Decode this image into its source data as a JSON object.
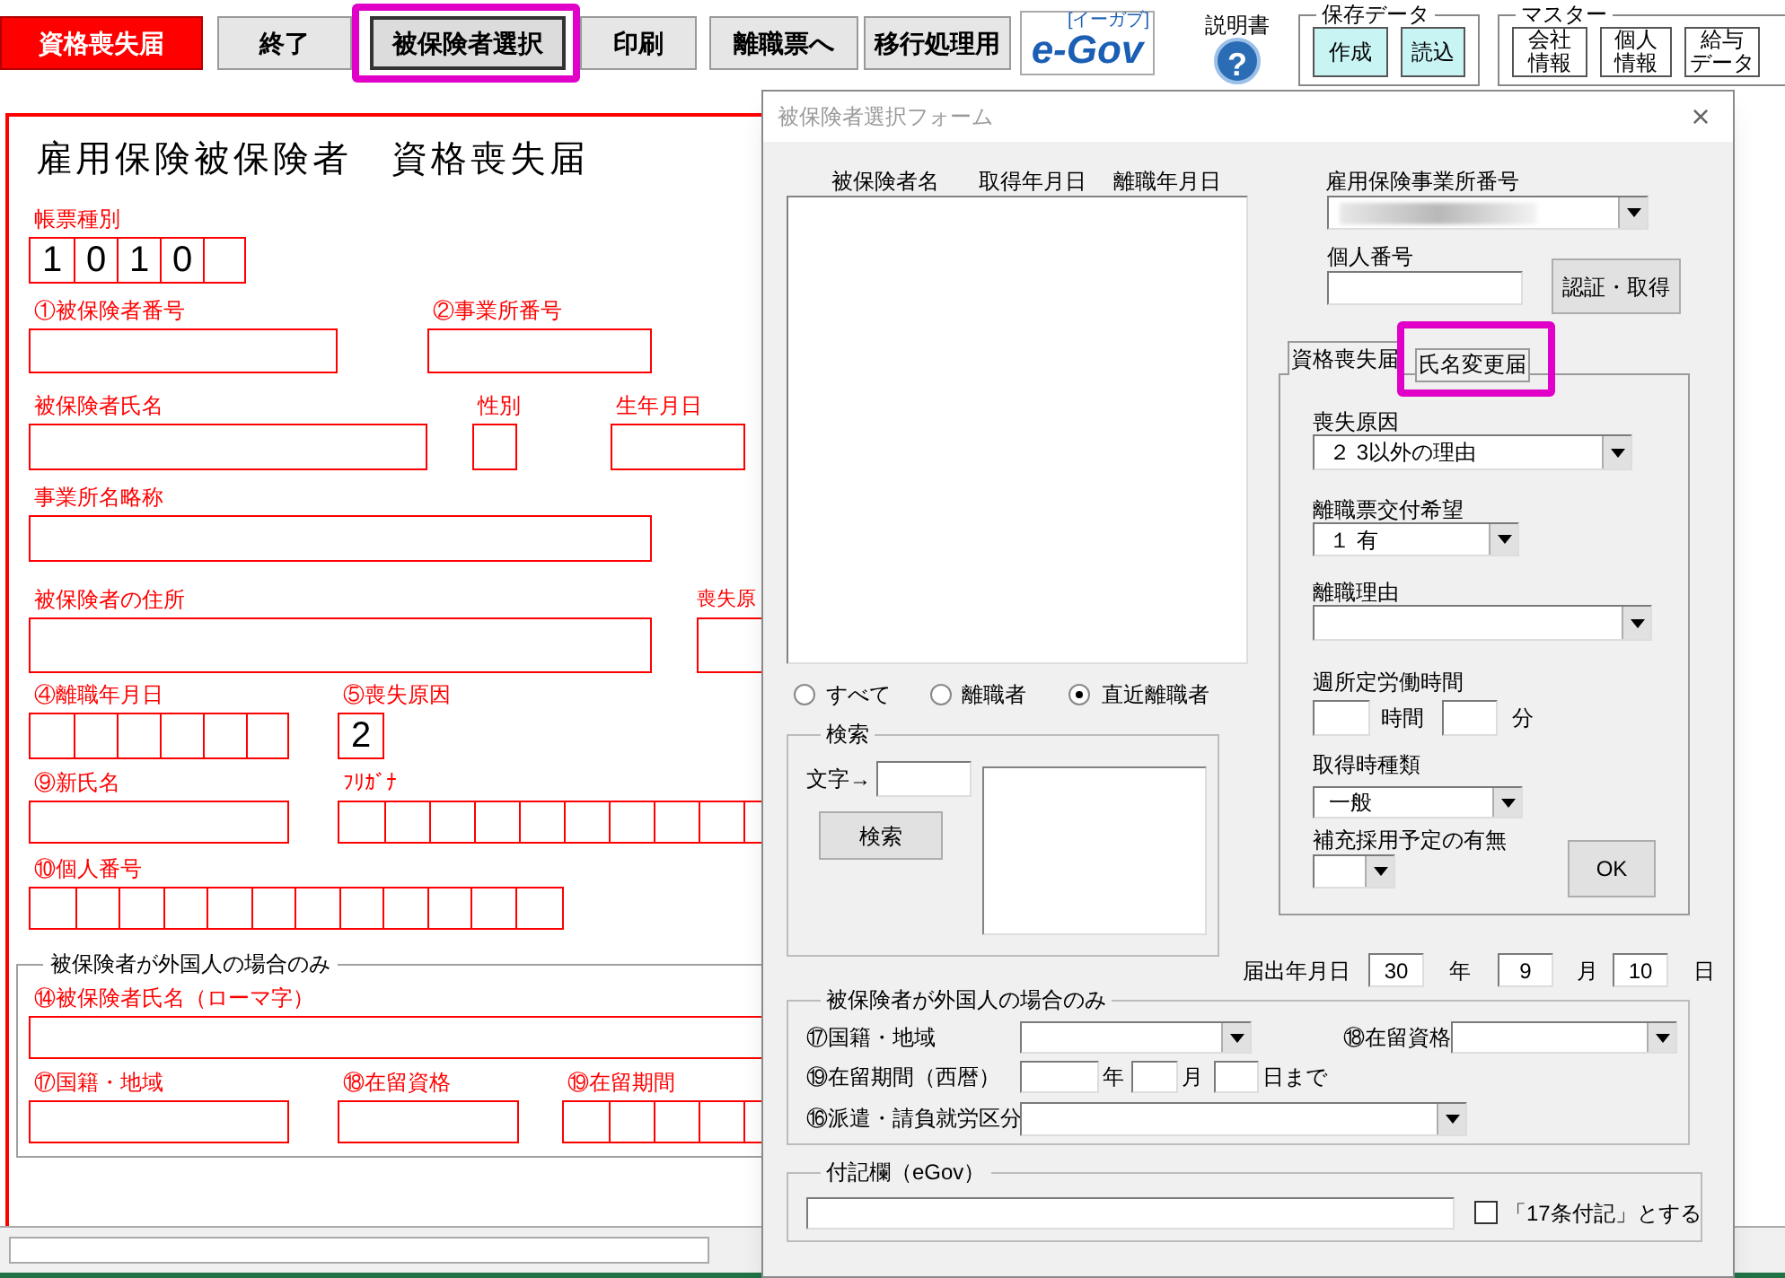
{
  "toolbar": {
    "badge": "資格喪失届",
    "buttons": [
      {
        "label": "終了",
        "selected": false,
        "highlighted": false
      },
      {
        "label": "被保険者選択",
        "selected": true,
        "highlighted": true
      },
      {
        "label": "印刷",
        "selected": false,
        "highlighted": false
      },
      {
        "label": "離職票へ",
        "selected": false,
        "highlighted": false
      },
      {
        "label": "移行処理用",
        "selected": false,
        "highlighted": false
      }
    ],
    "egov": {
      "logo": "e-Gov",
      "reading": "[イーガブ]"
    },
    "help": {
      "label": "説明書",
      "icon": "?"
    },
    "save_data": {
      "title": "保存データ",
      "buttons": [
        "作成",
        "読込"
      ]
    },
    "master": {
      "title": "マスター",
      "buttons": [
        "会社情報",
        "個人情報",
        "給与データ"
      ]
    }
  },
  "sheet": {
    "title": "雇用保険被保険者　資格喪失届",
    "rows": [
      [
        {
          "label": "帳票種別",
          "kind": "cells",
          "values": [
            "1",
            "0",
            "1",
            "0"
          ]
        }
      ],
      [
        {
          "label": "①被保険者番号",
          "kind": "box"
        },
        {
          "label": "②事業所番号",
          "kind": "box"
        }
      ],
      [
        {
          "label": "被保険者氏名",
          "kind": "box"
        },
        {
          "label": "性別",
          "kind": "box"
        },
        {
          "label": "生年月日",
          "kind": "box"
        }
      ],
      [
        {
          "label": "事業所名略称",
          "kind": "box"
        }
      ],
      [
        {
          "label": "被保険者の住所",
          "kind": "box"
        },
        {
          "label": "喪失原",
          "kind": "box"
        }
      ],
      [
        {
          "label": "④離職年月日",
          "kind": "cells"
        },
        {
          "label": "⑤喪失原因",
          "kind": "cells",
          "values": [
            "2"
          ]
        }
      ],
      [
        {
          "label": "⑨新氏名",
          "kind": "box"
        },
        {
          "label": "ﾌﾘｶﾞﾅ",
          "kind": "cells"
        }
      ],
      [
        {
          "label": "⑩個人番号",
          "kind": "cells"
        }
      ]
    ],
    "foreigner": {
      "title": "被保険者が外国人の場合のみ",
      "rows": [
        [
          {
            "label": "⑭被保険者氏名（ローマ字）",
            "kind": "box"
          }
        ],
        [
          {
            "label": "⑰国籍・地域",
            "kind": "box"
          },
          {
            "label": "⑱在留資格",
            "kind": "box"
          },
          {
            "label": "⑲在留期間",
            "kind": "cells"
          }
        ]
      ]
    }
  },
  "dialog": {
    "title": "被保険者選択フォーム",
    "close": "×",
    "list_columns": [
      "被保険者名",
      "取得年月日",
      "離職年月日"
    ],
    "filter": [
      {
        "label": "すべて",
        "selected": false
      },
      {
        "label": "離職者",
        "selected": false
      },
      {
        "label": "直近離職者",
        "selected": true
      }
    ],
    "search": {
      "title": "検索",
      "label": "文字→",
      "button": "検索"
    },
    "office_number": {
      "label": "雇用保険事業所番号",
      "redacted": true
    },
    "personal_number": {
      "label": "個人番号",
      "button": "認証・取得"
    },
    "tabs": [
      {
        "label": "資格喪失届",
        "selected": true,
        "highlighted": false
      },
      {
        "label": "氏名変更届",
        "selected": false,
        "highlighted": true
      }
    ],
    "loss": {
      "reason": {
        "label": "喪失原因",
        "value": "２ 3以外の理由"
      },
      "slip": {
        "label": "離職票交付希望",
        "value": "１ 有"
      },
      "separation_reason": {
        "label": "離職理由"
      },
      "weekly_hours": {
        "label": "週所定労働時間",
        "hour_unit": "時間",
        "minute_unit": "分"
      },
      "acquisition_type": {
        "label": "取得時種類",
        "value": "一般"
      },
      "replacement": {
        "label": "補充採用予定の有無"
      },
      "ok": "OK"
    },
    "filing_date": {
      "label": "届出年月日",
      "parts": [
        {
          "value": "30",
          "unit": "年"
        },
        {
          "value": "9",
          "unit": "月"
        },
        {
          "value": "10",
          "unit": "日"
        }
      ]
    },
    "foreigner": {
      "title": "被保険者が外国人の場合のみ",
      "nationality": "⑰国籍・地域",
      "status": "⑱在留資格",
      "period": {
        "label": "⑲在留期間（西暦）",
        "units": [
          "年",
          "月",
          "日まで"
        ]
      },
      "dispatch": "⑯派遣・請負就労区分"
    },
    "note": {
      "title": "付記欄（eGov）",
      "checkbox": {
        "label": "「17条付記」とする",
        "checked": false
      }
    }
  }
}
